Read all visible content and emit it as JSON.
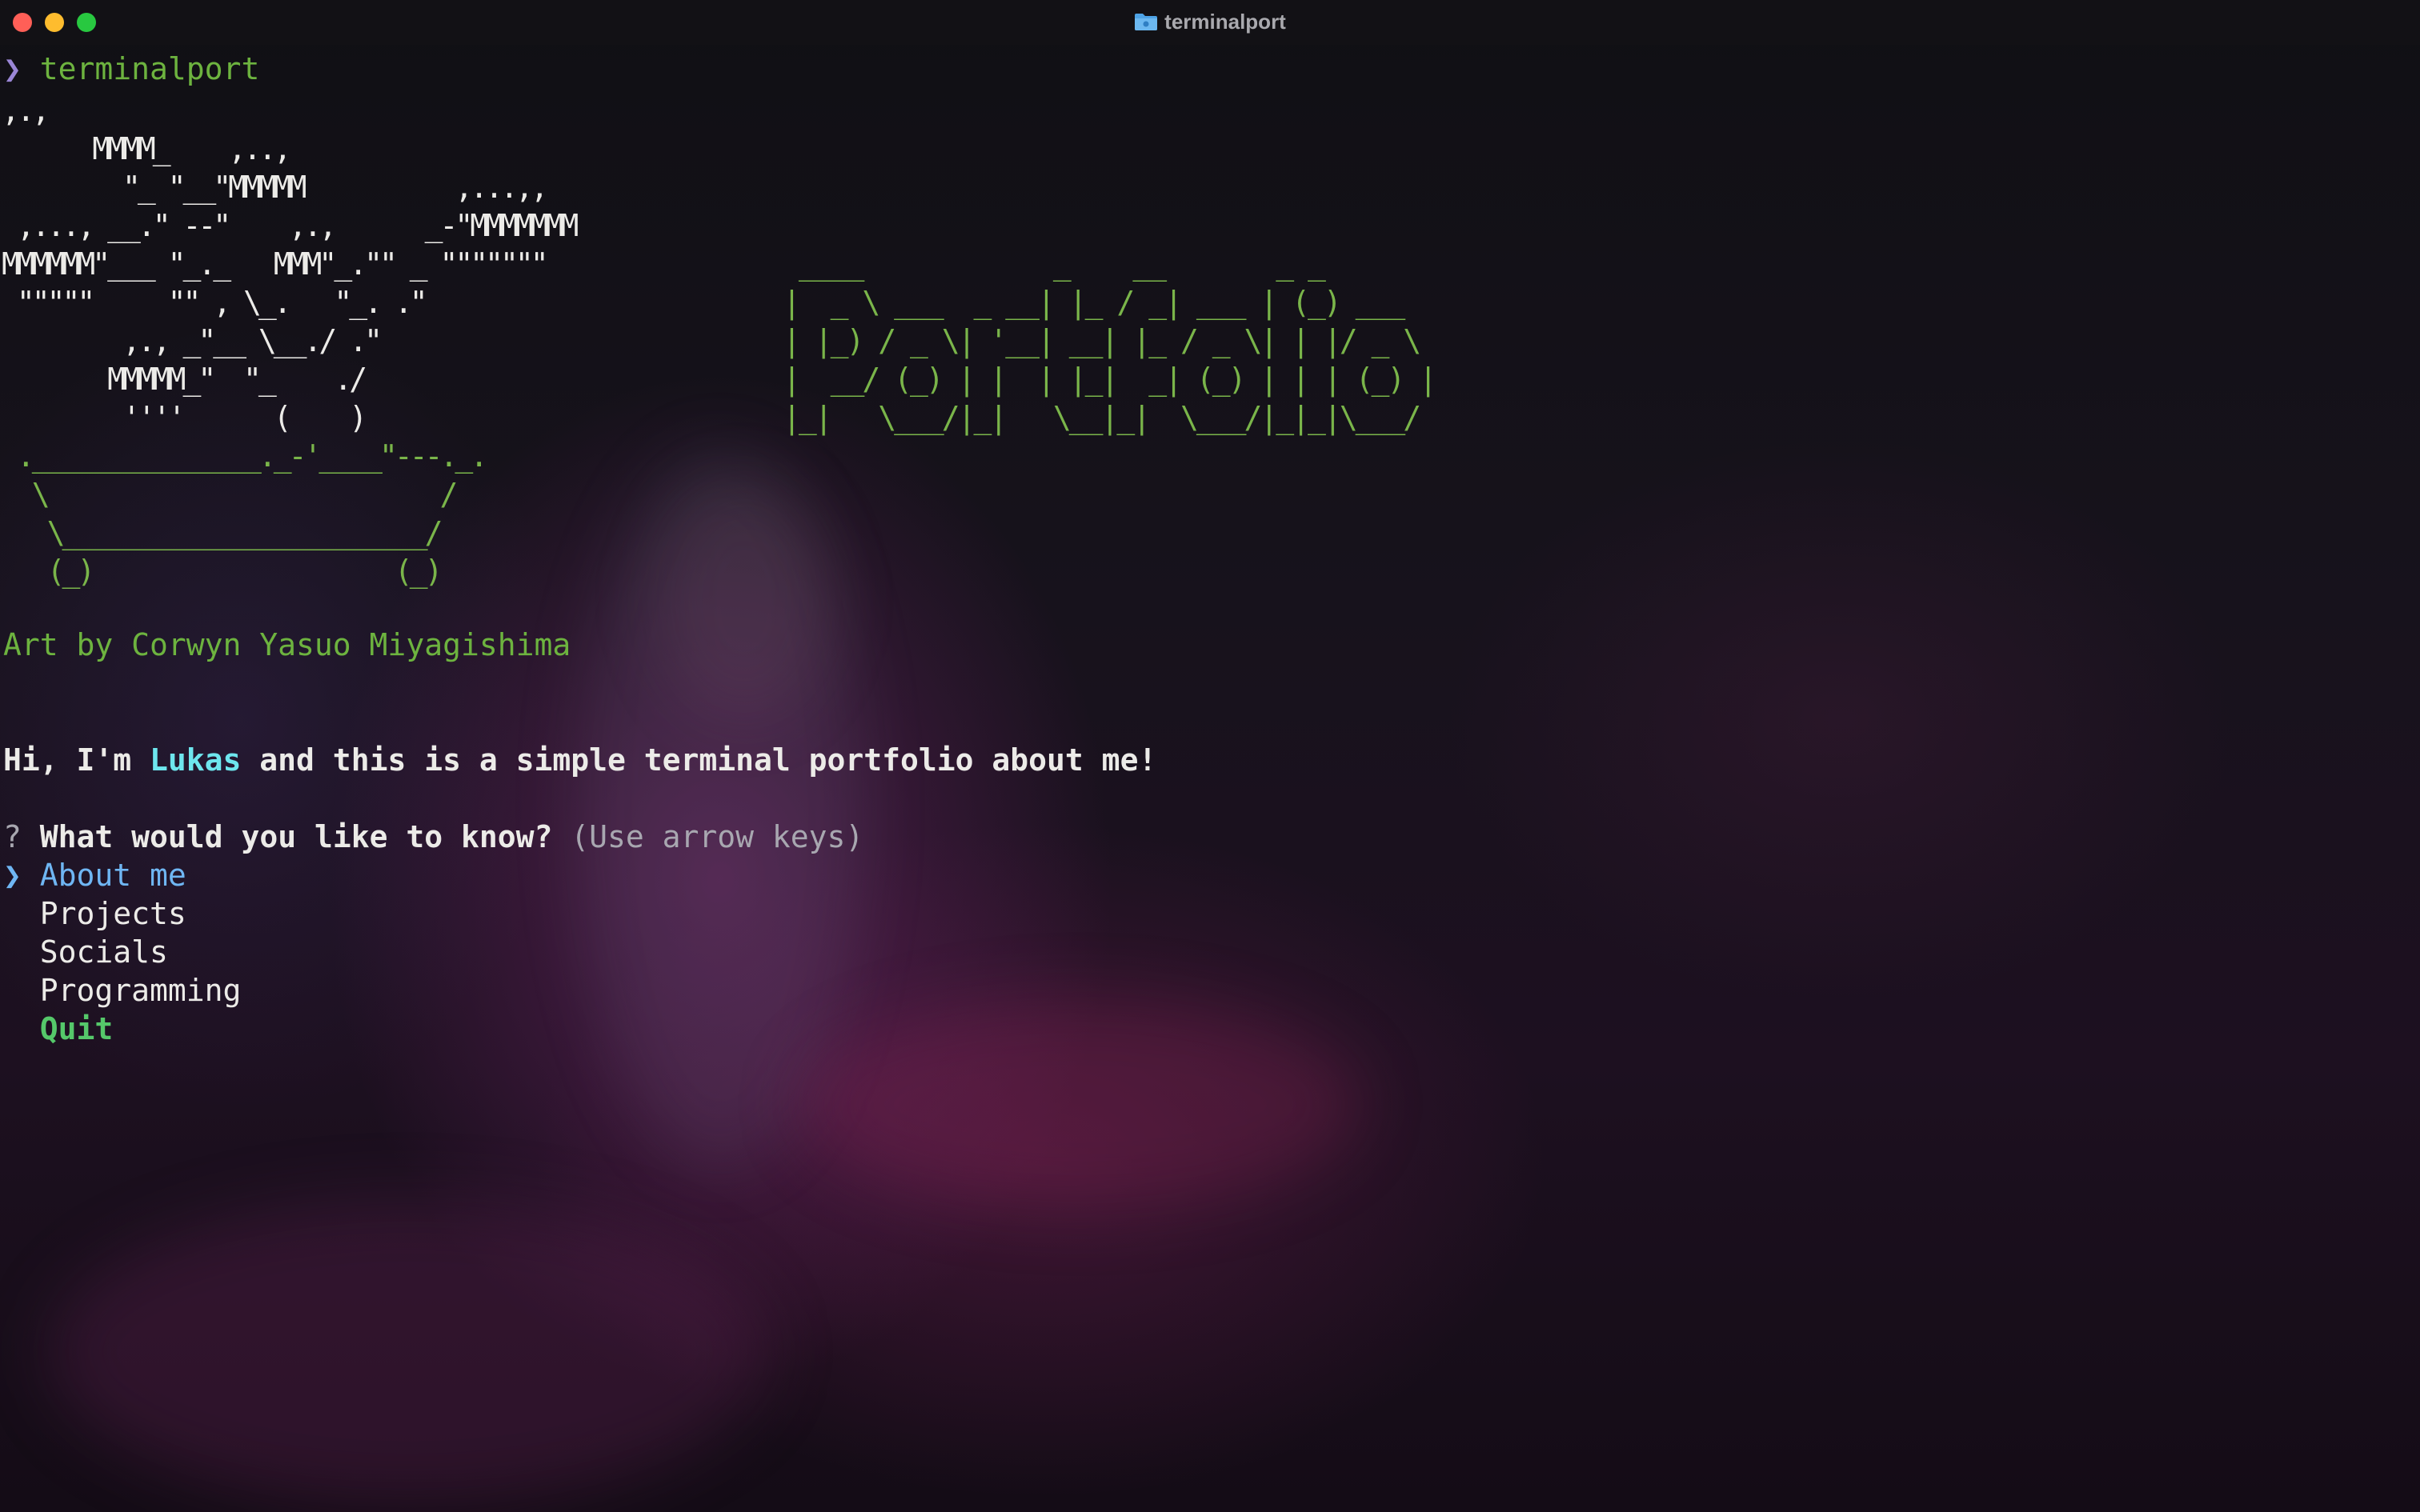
{
  "window": {
    "title": "terminalport",
    "folder_icon": "folder-icon"
  },
  "prompt": {
    "symbol": "❯",
    "command": "terminalport"
  },
  "art": {
    "bonsai_foliage": ",.,\n      MMMM_    ,..,\n        \"_ \"__\"MMMMM          ,...,,\n ,..., __.\" --\"    ,.,      _-\"MMMMMMM\nMMMMMM\"___ \"_._   MMM\"_.\"\" _ \"\"\"\"\"\"\"\n \"\"\"\"\"     \"\" , \\_.   \"_. .\"\n        ,., _\"__ \\__./ .\"\n       MMMMM_\"  \"_    ./\n        ''''      (    )",
    "bonsai_pot": " ._______________._-'____\"---._.\n  \\                          /\n   \\________________________/\n   (_)                    (_)",
    "portfolio_banner": " ____            _    __       _ _\n|  _ \\ ___  _ __| |_ / _| ___ | (_) ___\n| |_) / _ \\| '__| __| |_ / _ \\| | |/ _ \\\n|  __/ (_) | |  | |_|  _| (_) | | | (_) |\n|_|   \\___/|_|   \\__|_|  \\___/|_|_|\\___/",
    "credit": "Art by Corwyn Yasuo Miyagishima"
  },
  "intro": {
    "prefix": "Hi, I'm ",
    "name": "Lukas",
    "suffix": " and this is a simple terminal portfolio about me!"
  },
  "question": {
    "marker": "?",
    "text": "What would you like to know?",
    "hint": "(Use arrow keys)"
  },
  "menu": {
    "pointer": "❯",
    "selected": "About me",
    "items": [
      "Projects",
      "Socials",
      "Programming"
    ],
    "quit": "Quit"
  },
  "colors": {
    "prompt_symbol": "#9a86d6",
    "prompt_command": "#6db33f",
    "art_green": "#7ab54a",
    "name_cyan": "#6ee6ee",
    "selected_blue": "#6fb6f3",
    "quit_green": "#55c86a"
  }
}
